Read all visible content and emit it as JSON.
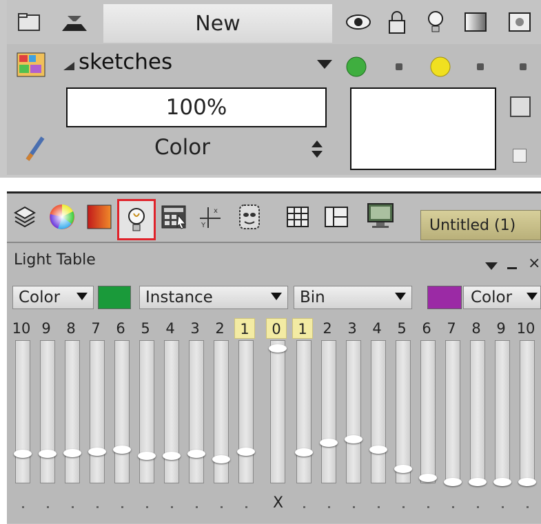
{
  "toolbar": {
    "new_label": "New",
    "icons": [
      "folder-icon",
      "flip-icon",
      "eye-icon",
      "lock-icon",
      "lightbulb-icon",
      "gradient-icon",
      "mask-icon"
    ]
  },
  "layer": {
    "name": "sketches",
    "opacity": "100%",
    "blend_mode": "Color"
  },
  "tabs": {
    "icons": [
      "layers-icon",
      "color-wheel-icon",
      "swatch-icon",
      "lightbulb-icon",
      "calculator-icon",
      "axis-icon",
      "mask-icon",
      "grid-icon",
      "frame-icon",
      "monitor-icon"
    ],
    "document_tab": "Untitled (1)"
  },
  "light_table": {
    "title": "Light Table",
    "left_mode": "Color",
    "left_color": "#1a9a3a",
    "instance_label": "Instance",
    "bin_label": "Bin",
    "right_color": "#9b2aa5",
    "right_mode": "Color",
    "numbers": [
      "10",
      "9",
      "8",
      "7",
      "6",
      "5",
      "4",
      "3",
      "2",
      "1",
      "0",
      "1",
      "2",
      "3",
      "4",
      "5",
      "6",
      "7",
      "8",
      "9",
      "10"
    ],
    "current_marker": "X"
  }
}
